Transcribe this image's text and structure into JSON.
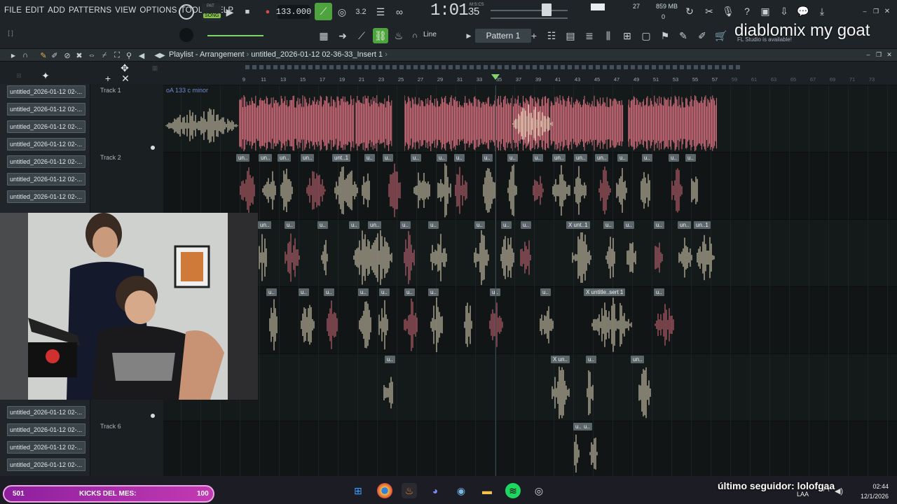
{
  "menu": [
    "FILE",
    "EDIT",
    "ADD",
    "PATTERNS",
    "VIEW",
    "OPTIONS",
    "TOOLS",
    "HELP"
  ],
  "transport": {
    "mode_pat": "PAT",
    "mode_song": "SONG",
    "tempo": "133.000",
    "time_main": "1:01",
    "time_sub": "35",
    "time_label": "M:S:CS",
    "cpu": "27",
    "memory": "859 MB",
    "memory_sub": "0",
    "snap": "Line",
    "pattern": "Pattern 1"
  },
  "overlay": {
    "title": "diablomix my goat",
    "update_hint": "FL Studio is available!"
  },
  "playlist": {
    "title": "Playlist - Arrangement",
    "file": "untitled_2026-01-12 02-36-33_Insert 1",
    "key": "oA 133 c minor"
  },
  "ruler": [
    "9",
    "11",
    "13",
    "15",
    "17",
    "19",
    "21",
    "23",
    "25",
    "27",
    "29",
    "31",
    "33",
    "35",
    "37",
    "39",
    "41",
    "43",
    "45",
    "47",
    "49",
    "51",
    "53",
    "55",
    "57",
    "59",
    "61",
    "63",
    "65",
    "67",
    "69",
    "71",
    "73"
  ],
  "browser_items": [
    "untitled_2026-01-12 02-...",
    "untitled_2026-01-12 02-...",
    "untitled_2026-01-12 02-...",
    "untitled_2026-01-12 02-...",
    "untitled_2026-01-12 02-...",
    "untitled_2026-01-12 02-...",
    "untitled_2026-01-12 02-...",
    "untitled_2026-01-12 02-...",
    "untitled_2026-01-12 02-...",
    "untitled_2026-01-12 02-...",
    "untitled_2026-01-12 02-..."
  ],
  "tracks": [
    "Track 1",
    "Track 2",
    "Track 6"
  ],
  "clip_labels": {
    "un": "un..",
    "unt1": "unt..1",
    "xunt1": "X unt..1",
    "u": "u..",
    "xuntsert": "X untitle..sert 1",
    "xun": "X un..",
    "un2": "un..1"
  },
  "taskbar": {
    "kicks_left": "501",
    "kicks_label": "KICKS DEL MES:",
    "kicks_right": "100",
    "follower": "último seguidor: lolofgaa",
    "time": "02:44",
    "date": "12/1/2026",
    "lang": "LAA"
  },
  "colors": {
    "waveform_red": "#d9707e",
    "waveform_cream": "#efe3c4",
    "clip_bg": "#5b656a",
    "accent_green": "#4fa33f"
  }
}
